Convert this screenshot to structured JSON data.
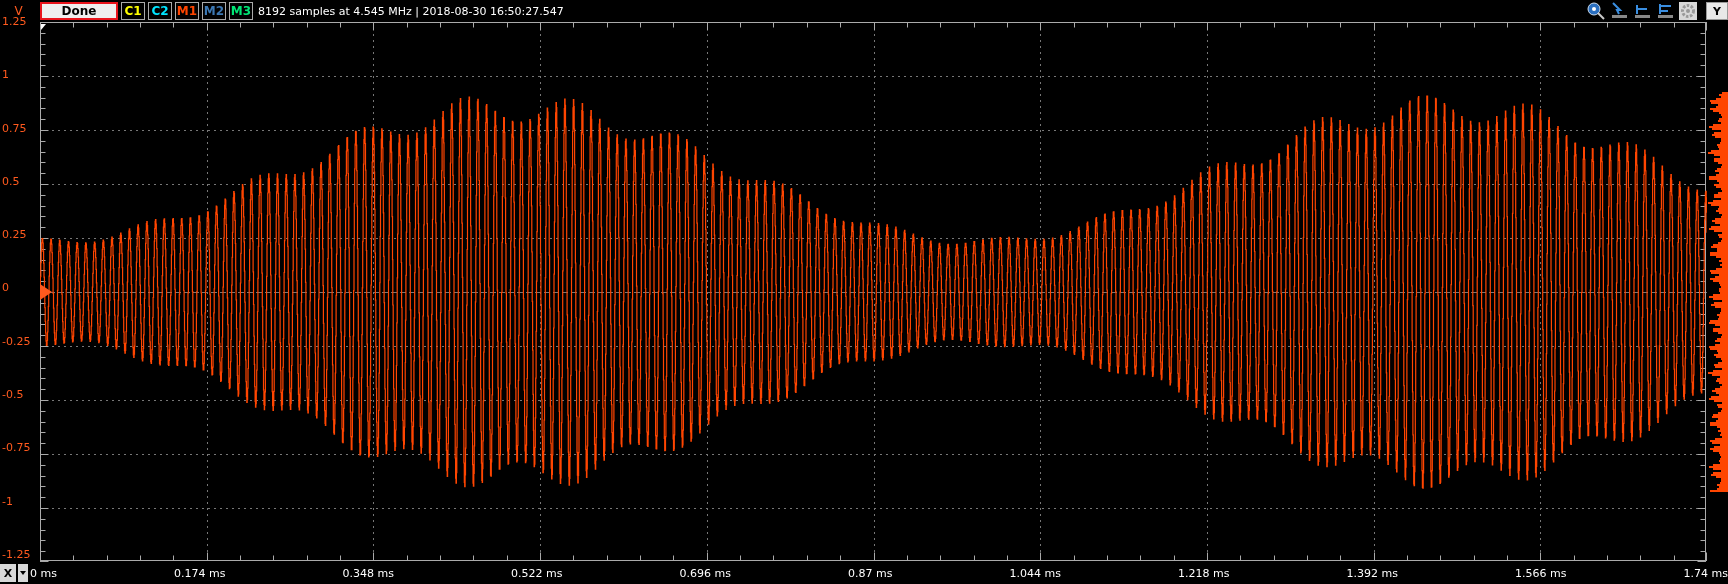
{
  "toolbar": {
    "axis_unit": "V",
    "run_button": "Done",
    "channels": [
      {
        "label": "C1",
        "color": "#ffff00"
      },
      {
        "label": "C2",
        "color": "#00e5ff"
      },
      {
        "label": "M1",
        "color": "#ff4500"
      },
      {
        "label": "M2",
        "color": "#3c78b4"
      },
      {
        "label": "M3",
        "color": "#00e676"
      }
    ],
    "info": "8192 samples at 4.545 MHz | 2018-08-30 16:50:27.547",
    "y_button": "Y"
  },
  "y_axis": {
    "labels": [
      "1.25",
      "1",
      "0.75",
      "0.5",
      "0.25",
      "0",
      "-0.25",
      "-0.5",
      "-0.75",
      "-1",
      "-1.25"
    ]
  },
  "x_axis": {
    "button": "X",
    "labels": [
      "0 ms",
      "0.174 ms",
      "0.348 ms",
      "0.522 ms",
      "0.696 ms",
      "0.87 ms",
      "1.044 ms",
      "1.218 ms",
      "1.392 ms",
      "1.566 ms",
      "1.74 ms"
    ]
  }
}
